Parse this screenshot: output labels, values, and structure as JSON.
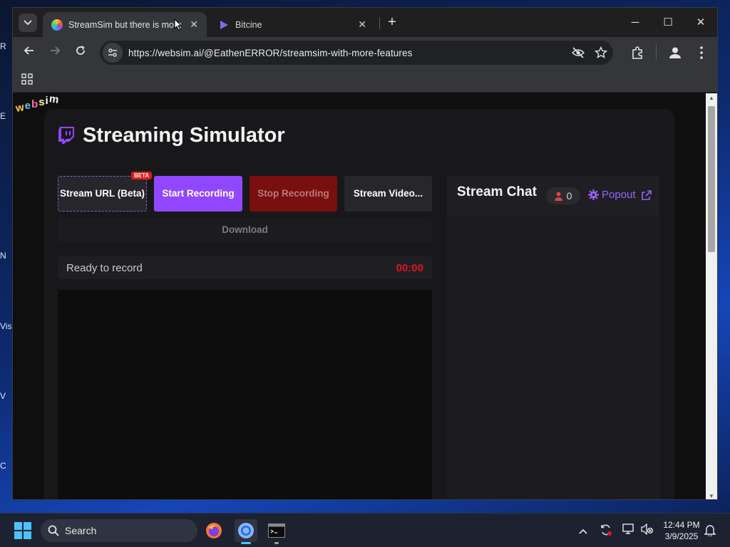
{
  "browser": {
    "active_tab_title": "StreamSim but there is more fe",
    "inactive_tab_title": "Bitcine",
    "url": "https://websim.ai/@EathenERROR/streamsim-with-more-features"
  },
  "websim_logo": [
    "w",
    "e",
    "b",
    "s",
    "i",
    "m"
  ],
  "app": {
    "title": "Streaming Simulator",
    "buttons": {
      "stream_url": "Stream URL (Beta)",
      "beta_badge": "BETA",
      "start_recording": "Start Recording",
      "stop_recording": "Stop Recording",
      "stream_video": "Stream Video...",
      "download": "Download"
    },
    "status": "Ready to record",
    "timer": "00:00",
    "chat": {
      "title": "Stream Chat",
      "viewer_count": "0",
      "popout_label": "Popout"
    }
  },
  "taskbar": {
    "search_placeholder": "Search",
    "time": "12:44 PM",
    "date": "3/9/2025"
  },
  "colors": {
    "accent": "#9147ff",
    "stop": "#7a0f0f",
    "timer": "#e1141f",
    "beta": "#e01b1b"
  },
  "desktop_fragments": [
    "R",
    "E",
    "N",
    "Vis",
    "V",
    "C"
  ]
}
